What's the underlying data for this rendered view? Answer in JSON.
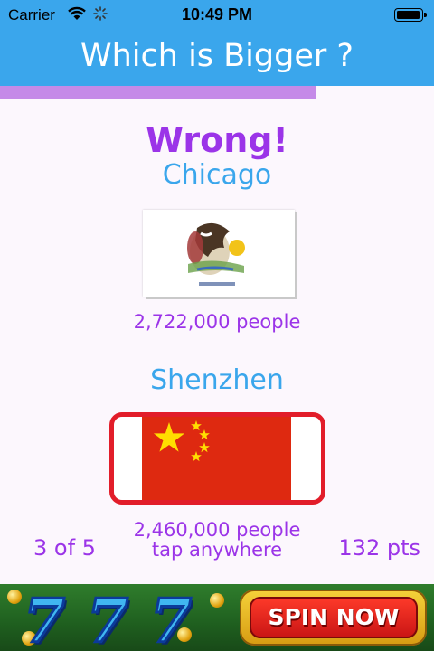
{
  "status_bar": {
    "carrier": "Carrier",
    "time": "10:49 PM",
    "battery_level": 0.95
  },
  "nav": {
    "title": "Which is Bigger ?"
  },
  "progress": {
    "fraction": 0.73
  },
  "result": {
    "text": "Wrong!"
  },
  "city1": {
    "name": "Chicago",
    "population": "2,722,000 people",
    "flag_icon": "illinois-flag-icon"
  },
  "city2": {
    "name": "Shenzhen",
    "population": "2,460,000 people",
    "flag_icon": "china-flag-icon"
  },
  "hint": "tap anywhere",
  "question_counter": "3 of 5",
  "score": "132 pts",
  "ad": {
    "cta": "SPIN NOW",
    "symbols": [
      "7",
      "7",
      "7"
    ]
  },
  "colors": {
    "accent_blue": "#3aa6ec",
    "accent_purple": "#9b34e8",
    "highlight_red": "#e21d2a",
    "progress_purple": "#c58ae8"
  }
}
